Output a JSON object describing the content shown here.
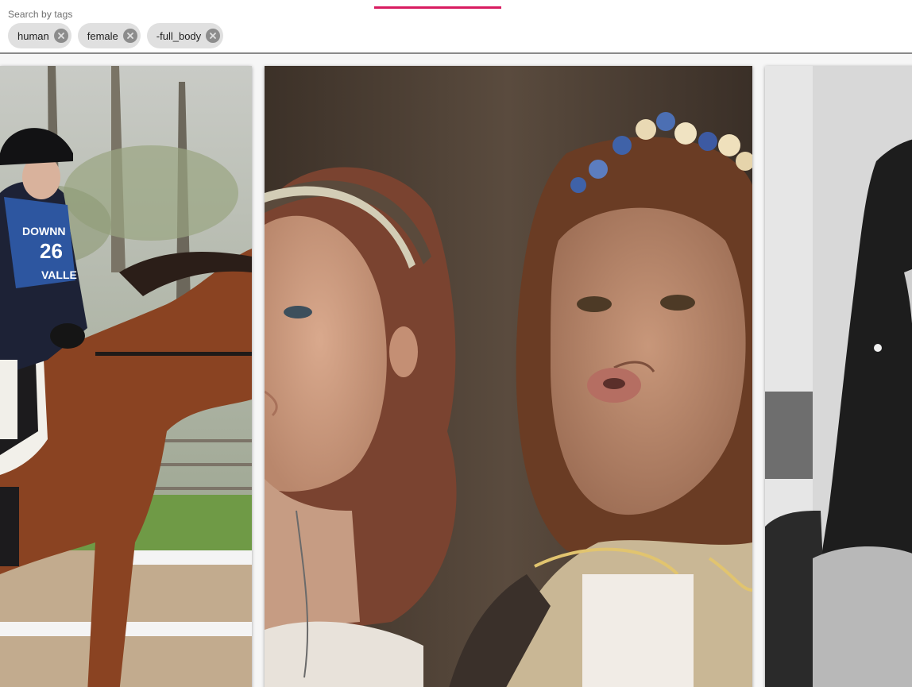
{
  "search": {
    "label": "Search by tags",
    "tags": [
      "human",
      "female",
      "-full_body"
    ]
  },
  "gallery": {
    "images": [
      {
        "name": "horse-rider-image",
        "description": "Rider in black helmet and blue numbered bib on a brown horse"
      },
      {
        "name": "two-women-portrait-image",
        "description": "Two young women, one wearing a floral crown"
      },
      {
        "name": "bw-woman-portrait-image",
        "description": "Black and white portrait of a woman with dark hair"
      }
    ],
    "bib_text": [
      "DOWNN",
      "26",
      "VALLE"
    ]
  },
  "colors": {
    "accent": "#d81b60",
    "chip_bg": "#e0e0e0",
    "chip_icon": "#8c8c8c"
  }
}
